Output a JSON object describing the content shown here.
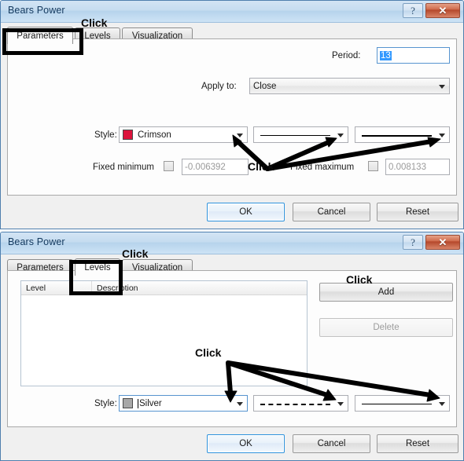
{
  "dialogs": [
    {
      "id": "parameters-dialog",
      "title": "Bears Power",
      "titlebar": {
        "help_label": "?",
        "close_label": "✕"
      },
      "tabs": [
        {
          "label": "Parameters",
          "selected": true
        },
        {
          "label": "Levels",
          "selected": false
        },
        {
          "label": "Visualization",
          "selected": false
        }
      ],
      "fields": {
        "period_label": "Period:",
        "period_value": "13",
        "apply_to_label": "Apply to:",
        "apply_to_value": "Close",
        "style_label": "Style:",
        "style_color_name": "Crimson",
        "style_color_hex": "#DC143C",
        "line_style_preview": "solid-thin",
        "line_width_preview": "solid-thick",
        "fixed_minimum_label": "Fixed minimum",
        "fixed_minimum_value": "-0.006392",
        "fixed_minimum_checked": false,
        "fixed_maximum_label": "Fixed maximum",
        "fixed_maximum_value": "0.008133",
        "fixed_maximum_checked": false
      },
      "buttons": {
        "ok": "OK",
        "cancel": "Cancel",
        "reset": "Reset"
      }
    },
    {
      "id": "levels-dialog",
      "title": "Bears Power",
      "titlebar": {
        "help_label": "?",
        "close_label": "✕"
      },
      "tabs": [
        {
          "label": "Parameters",
          "selected": false
        },
        {
          "label": "Levels",
          "selected": true
        },
        {
          "label": "Visualization",
          "selected": false
        }
      ],
      "levels_list": {
        "columns": [
          "Level",
          "Description"
        ],
        "rows": []
      },
      "side_buttons": {
        "add": "Add",
        "delete": "Delete",
        "delete_disabled": true
      },
      "fields": {
        "style_label": "Style:",
        "style_color_name": "Silver",
        "style_color_hex": "#A8A8A8",
        "line_style_preview": "dashed",
        "line_width_preview": "solid-thin"
      },
      "buttons": {
        "ok": "OK",
        "cancel": "Cancel",
        "reset": "Reset"
      }
    }
  ],
  "annotations": {
    "click_parameters_tab": "Click",
    "click_parameters_style": "Click",
    "click_levels_tab": "Click",
    "click_levels_add": "Click",
    "click_levels_style": "Click"
  }
}
